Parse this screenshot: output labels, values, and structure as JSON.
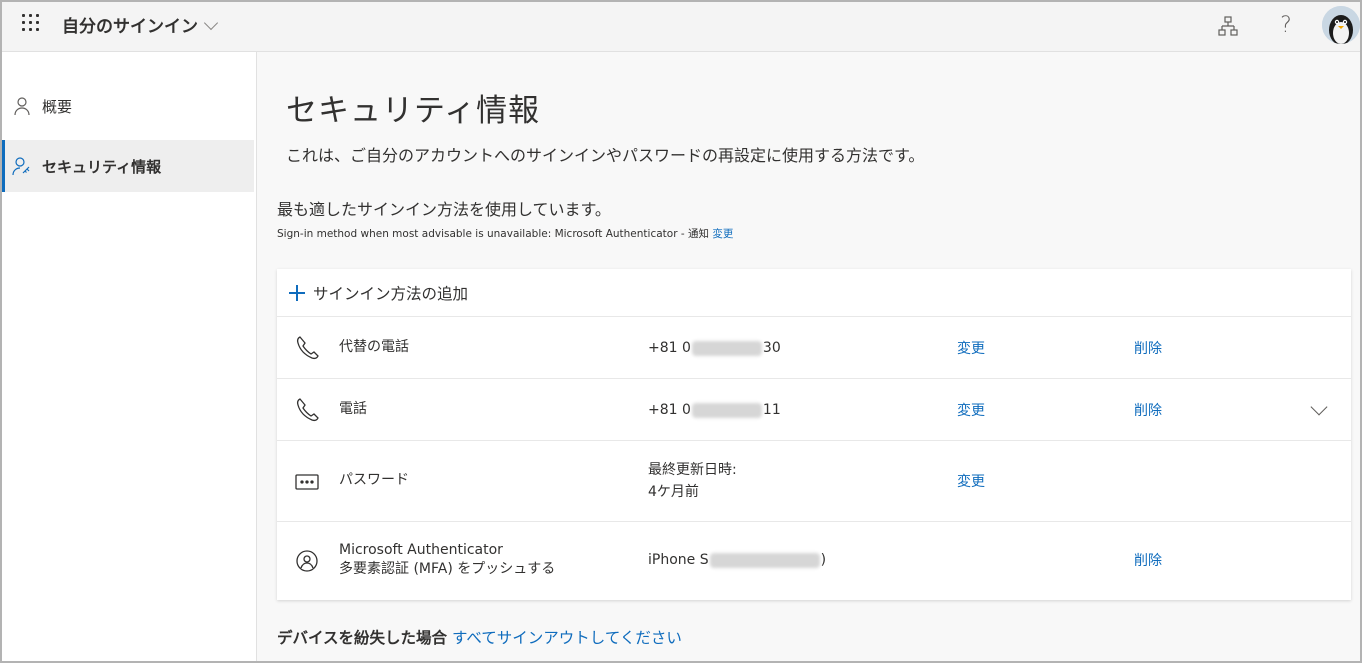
{
  "header": {
    "app_title": "自分のサインイン",
    "help_label": "?"
  },
  "sidebar": {
    "items": [
      {
        "label": "概要",
        "icon": "person-icon"
      },
      {
        "label": "セキュリティ情報",
        "icon": "person-key-icon",
        "selected": true
      }
    ]
  },
  "main": {
    "title": "セキュリティ情報",
    "description": "これは、ご自分のアカウントへのサインインやパスワードの再設定に使用する方法です。",
    "default_method": "最も適したサインイン方法を使用しています。",
    "note_text": "Sign-in method when most advisable is unavailable: Microsoft Authenticator - 通知",
    "note_link": "変更",
    "add_method": "サインイン方法の追加",
    "methods": [
      {
        "icon": "phone-icon",
        "name": "代替の電話",
        "detail_prefix": "+81 0",
        "detail_suffix": "30",
        "change": "変更",
        "delete": "削除"
      },
      {
        "icon": "phone-icon",
        "name": "電話",
        "detail_prefix": "+81 0",
        "detail_suffix": "11",
        "change": "変更",
        "delete": "削除",
        "expandable": true
      },
      {
        "icon": "password-icon",
        "name": "パスワード",
        "detail_line1": "最終更新日時:",
        "detail_line2": "4ケ月前",
        "change": "変更"
      },
      {
        "icon": "authenticator-icon",
        "name_line1": "Microsoft Authenticator",
        "name_line2": "多要素認証 (MFA) をプッシュする",
        "detail_prefix": "iPhone S",
        "detail_suffix": ")",
        "delete": "削除"
      }
    ],
    "lost_device_label": "デバイスを紛失した場合",
    "lost_device_link": "すべてサインアウトしてください"
  },
  "colors": {
    "accent": "#0f6cbd",
    "text": "#323130",
    "background": "#f8f8f8"
  }
}
